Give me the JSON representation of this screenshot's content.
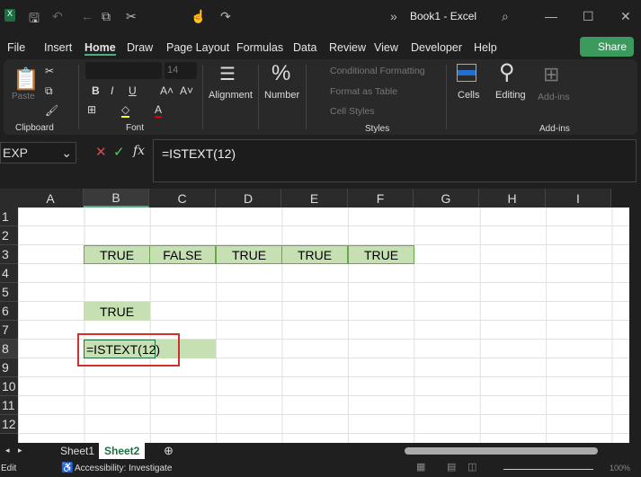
{
  "title": "Book1 - Excel",
  "tabs": [
    "File",
    "Insert",
    "Home",
    "Draw",
    "Page Layout",
    "Formulas",
    "Data",
    "Review",
    "View",
    "Developer",
    "Help"
  ],
  "share": "Share",
  "ribbon": {
    "paste": "Paste",
    "clipboard": "Clipboard",
    "font_size": "14",
    "font": "Font",
    "alignment": "Alignment",
    "number": "Number",
    "cond_format": "Conditional Formatting",
    "format_table": "Format as Table",
    "cell_styles": "Cell Styles",
    "styles": "Styles",
    "cells": "Cells",
    "editing": "Editing",
    "addins": "Add-ins",
    "addins_group": "Add-ins"
  },
  "formula_bar": {
    "name_box": "EXP",
    "formula": "=ISTEXT(12)",
    "fx": "fx"
  },
  "columns": [
    "A",
    "B",
    "C",
    "D",
    "E",
    "F",
    "G",
    "H",
    "I"
  ],
  "rows": [
    "1",
    "2",
    "3",
    "4",
    "5",
    "6",
    "7",
    "8",
    "9",
    "10",
    "11",
    "12"
  ],
  "cells": {
    "B3": "TRUE",
    "C3": "FALSE",
    "D3": "TRUE",
    "E3": "TRUE",
    "F3": "TRUE",
    "B6": "TRUE",
    "B8": "=ISTEXT(12)"
  },
  "sheets": [
    "Sheet1",
    "Sheet2"
  ],
  "status": {
    "mode": "Edit",
    "accessibility": "Accessibility: Investigate",
    "zoom": "100%"
  },
  "colors": {
    "green_fill": "#c6e0b4",
    "highlight": "#d32f2f",
    "share": "#3c9a5f"
  }
}
